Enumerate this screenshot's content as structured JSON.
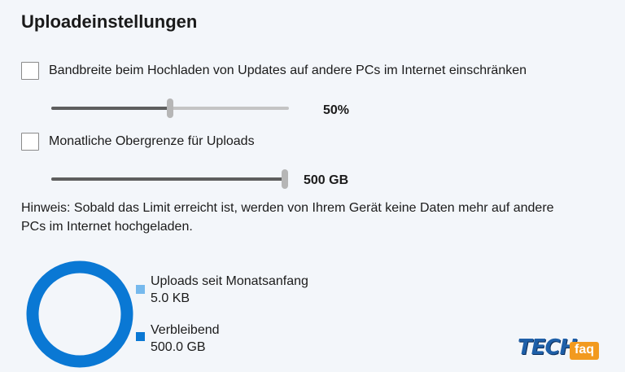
{
  "page": {
    "title": "Uploadeinstellungen"
  },
  "bandwidth": {
    "checkbox_label": "Bandbreite beim Hochladen von Updates auf andere PCs im Internet einschränken",
    "checked": false,
    "slider_value_label": "50%",
    "slider_fraction": 0.5
  },
  "monthly_cap": {
    "checkbox_label": "Monatliche Obergrenze für Uploads",
    "checked": false,
    "slider_value_label": "500 GB",
    "slider_fraction": 1.0
  },
  "hint": {
    "text": "Hinweis: Sobald das Limit erreicht ist, werden von Ihrem Gerät keine Daten mehr auf andere PCs im Internet hochgeladen."
  },
  "usage": {
    "uploaded": {
      "label": "Uploads seit Monatsanfang",
      "value": "5.0 KB",
      "color": "#76b9ed"
    },
    "remaining": {
      "label": "Verbleibend",
      "value": "500.0 GB",
      "color": "#0a78d4"
    }
  },
  "logo": {
    "text_main": "TECH",
    "text_badge": "faq",
    "colors": {
      "main": "#1e5fa8",
      "badge": "#f29a1f"
    }
  }
}
